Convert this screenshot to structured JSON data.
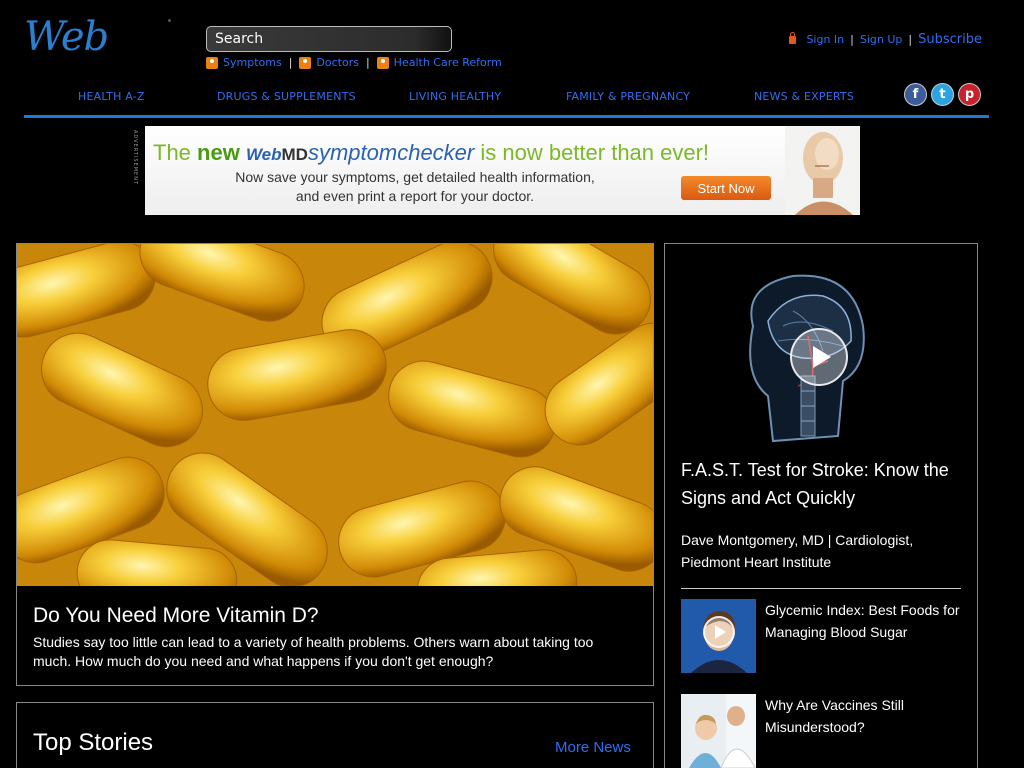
{
  "header": {
    "logo": "Web",
    "search_placeholder": "Search",
    "quicklinks": [
      {
        "label": "Symptoms",
        "icon": "person-icon"
      },
      {
        "label": "Doctors",
        "icon": "doctor-icon"
      },
      {
        "label": "Health Care Reform",
        "icon": "building-icon"
      }
    ],
    "account": {
      "sign_in": "Sign In",
      "sign_up": "Sign Up",
      "subscribe": "Subscribe",
      "sep": "|"
    }
  },
  "nav": {
    "items": [
      "HEALTH A-Z",
      "DRUGS & SUPPLEMENTS",
      "LIVING HEALTHY",
      "FAMILY & PREGNANCY",
      "NEWS & EXPERTS"
    ],
    "social": [
      {
        "name": "facebook",
        "glyph": "f"
      },
      {
        "name": "twitter",
        "glyph": "t"
      },
      {
        "name": "pinterest",
        "glyph": "p"
      }
    ],
    "accent_color": "#1b7ad6"
  },
  "ad": {
    "label": "ADVERTISEMENT",
    "headline_pre": "The ",
    "headline_new": "new ",
    "headline_brand_web": "Web",
    "headline_brand_md": "MD",
    "headline_symptom": "symptomchecker",
    "headline_post": " is now better than ever!",
    "sub1": "Now save your symptoms, get detailed health information,",
    "sub2": "and even print a report for your doctor.",
    "button": "Start Now"
  },
  "feature": {
    "title": "Do You Need More Vitamin D?",
    "description": "Studies say too little can lead to a variety of health problems. Others warn about taking too much. How much do you need and what happens if you don't get enough?"
  },
  "top_stories": {
    "title": "Top Stories",
    "more": "More News"
  },
  "sidebar": {
    "video_title": "F.A.S.T. Test for Stroke: Know the Signs and Act Quickly",
    "author": "Dave Montgomery, MD | Cardiologist, Piedmont Heart Institute",
    "items": [
      {
        "title": "Glycemic Index: Best Foods for Managing Blood Sugar",
        "has_video": true
      },
      {
        "title": "Why Are Vaccines Still Misunderstood?",
        "has_video": false
      }
    ]
  }
}
